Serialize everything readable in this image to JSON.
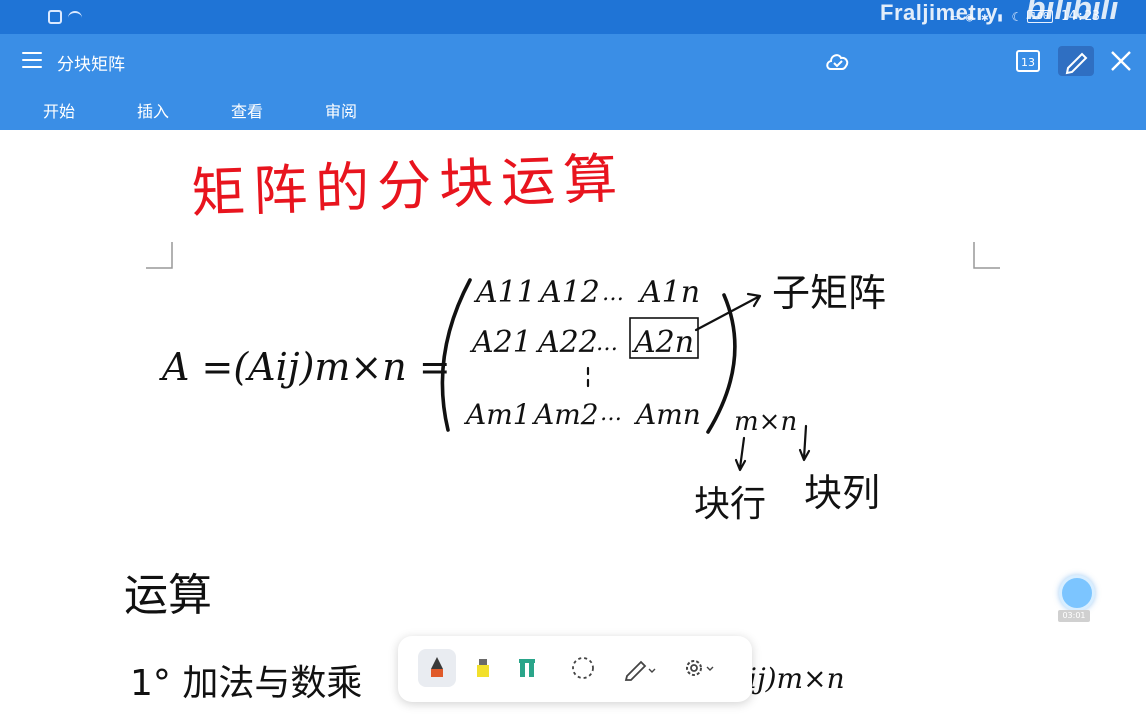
{
  "status_bar": {
    "time": "14:23",
    "battery": "100"
  },
  "app": {
    "title": "分块矩阵",
    "page_count": "13",
    "watermark": "Fraljimetry",
    "bili_logo": "bilibili"
  },
  "tabs": [
    {
      "label": "开始"
    },
    {
      "label": "插入"
    },
    {
      "label": "查看"
    },
    {
      "label": "审阅"
    }
  ],
  "note": {
    "heading": "矩阵的分块运算",
    "lhs": "A =(Aij)m×n =",
    "rows": [
      [
        "A11",
        "A12",
        "…",
        "A1n"
      ],
      [
        "A21",
        "A22",
        "…",
        "A2n"
      ],
      [
        "Am1",
        "Am2",
        "…",
        "Amn"
      ]
    ],
    "subscript": "m×n",
    "sub_matrix_label": "子矩阵",
    "block_row_label": "块行",
    "block_col_label": "块列",
    "ops_heading": "运算",
    "item_1": "1° 加法与数乘",
    "item_1_tail": "ij)m×n"
  },
  "floating_ball": {
    "label": "03:01"
  },
  "toolbar_tools": [
    {
      "name": "pen-tool",
      "active": true
    },
    {
      "name": "highlighter-tool",
      "active": false
    },
    {
      "name": "marker-tool",
      "active": false
    },
    {
      "name": "lasso-tool",
      "active": false
    },
    {
      "name": "pencil-options-tool",
      "active": false
    },
    {
      "name": "settings-tool",
      "active": false
    }
  ],
  "colors": {
    "app_bar": "#3a8ee6",
    "status_bar": "#1f74d6",
    "heading_ink": "#e8141e",
    "ink": "#111111"
  }
}
